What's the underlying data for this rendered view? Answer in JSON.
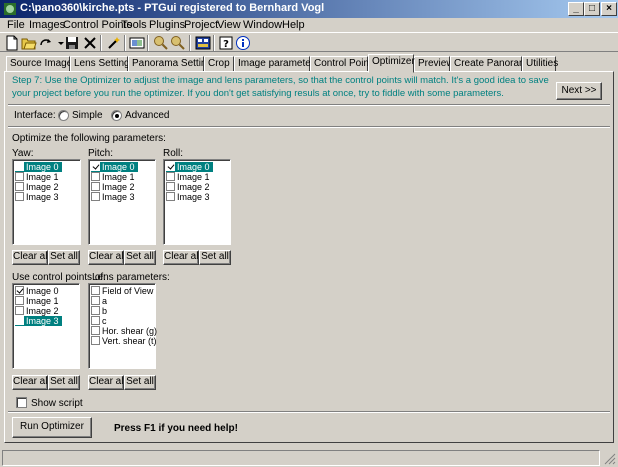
{
  "window": {
    "title": "C:\\pano360\\kirche.pts - PTGui registered to Bernhard Vogl",
    "minimize": "_",
    "maximize": "□",
    "close": "×"
  },
  "menu": [
    "File",
    "Images",
    "Control Points",
    "Tools",
    "Plugins",
    "Project",
    "View",
    "Window",
    "Help"
  ],
  "toolbar": {
    "icons": [
      "new-icon",
      "open-icon",
      "redo-icon",
      "save-icon",
      "delete-icon",
      "wand-icon",
      "stitch-icon",
      "zoom-in-icon",
      "zoom-out-icon",
      "panorama-editor-icon",
      "help-icon",
      "info-icon"
    ]
  },
  "tabs": [
    "Source Images",
    "Lens Settings",
    "Panorama Settings",
    "Crop",
    "Image parameters",
    "Control Points",
    "Optimizer",
    "Preview",
    "Create Panorama",
    "Utilities"
  ],
  "active_tab": "Optimizer",
  "step": {
    "text": "Step 7: Use the Optimizer to adjust the image and lens parameters, so that the control points will match. It's a good idea to save your project before you run the optimizer. If you don't get satisfying resuls at once, try to fiddle with some parameters.",
    "next_label": "Next >>"
  },
  "interface": {
    "label": "Interface:",
    "simple": "Simple",
    "advanced": "Advanced",
    "selected": "Advanced"
  },
  "optimize": {
    "heading": "Optimize the following parameters:",
    "yaw": {
      "label": "Yaw:",
      "items": [
        {
          "label": "Image 0",
          "checked": false,
          "selected": true
        },
        {
          "label": "Image 1",
          "checked": false,
          "selected": false
        },
        {
          "label": "Image 2",
          "checked": false,
          "selected": false
        },
        {
          "label": "Image 3",
          "checked": false,
          "selected": false
        }
      ]
    },
    "pitch": {
      "label": "Pitch:",
      "items": [
        {
          "label": "Image 0",
          "checked": true,
          "selected": true
        },
        {
          "label": "Image 1",
          "checked": false,
          "selected": false
        },
        {
          "label": "Image 2",
          "checked": false,
          "selected": false
        },
        {
          "label": "Image 3",
          "checked": false,
          "selected": false
        }
      ]
    },
    "roll": {
      "label": "Roll:",
      "items": [
        {
          "label": "Image 0",
          "checked": true,
          "selected": true
        },
        {
          "label": "Image 1",
          "checked": false,
          "selected": false
        },
        {
          "label": "Image 2",
          "checked": false,
          "selected": false
        },
        {
          "label": "Image 3",
          "checked": false,
          "selected": false
        }
      ]
    }
  },
  "control_points": {
    "label": "Use control points of:",
    "items": [
      {
        "label": "Image 0",
        "checked": true,
        "selected": false
      },
      {
        "label": "Image 1",
        "checked": false,
        "selected": false
      },
      {
        "label": "Image 2",
        "checked": false,
        "selected": false
      },
      {
        "label": "Image 3",
        "checked": false,
        "selected": true
      }
    ]
  },
  "lens": {
    "label": "Lens parameters:",
    "items": [
      {
        "label": "Field of View",
        "checked": false,
        "selected": false
      },
      {
        "label": "a",
        "checked": false,
        "selected": false
      },
      {
        "label": "b",
        "checked": false,
        "selected": false
      },
      {
        "label": "c",
        "checked": false,
        "selected": false
      },
      {
        "label": "Hor. shear (g)",
        "checked": false,
        "selected": false
      },
      {
        "label": "Vert. shear (t)",
        "checked": false,
        "selected": false
      }
    ]
  },
  "buttons": {
    "clear_all": "Clear all",
    "set_all": "Set all",
    "run_optimizer": "Run Optimizer"
  },
  "show_script": "Show script",
  "help_hint": "Press F1 if you need help!",
  "colors": {
    "title_start": "#0a246a",
    "title_end": "#a6caf0",
    "selection": "#008080",
    "step_text": "#008080",
    "face": "#d4d0c8"
  }
}
